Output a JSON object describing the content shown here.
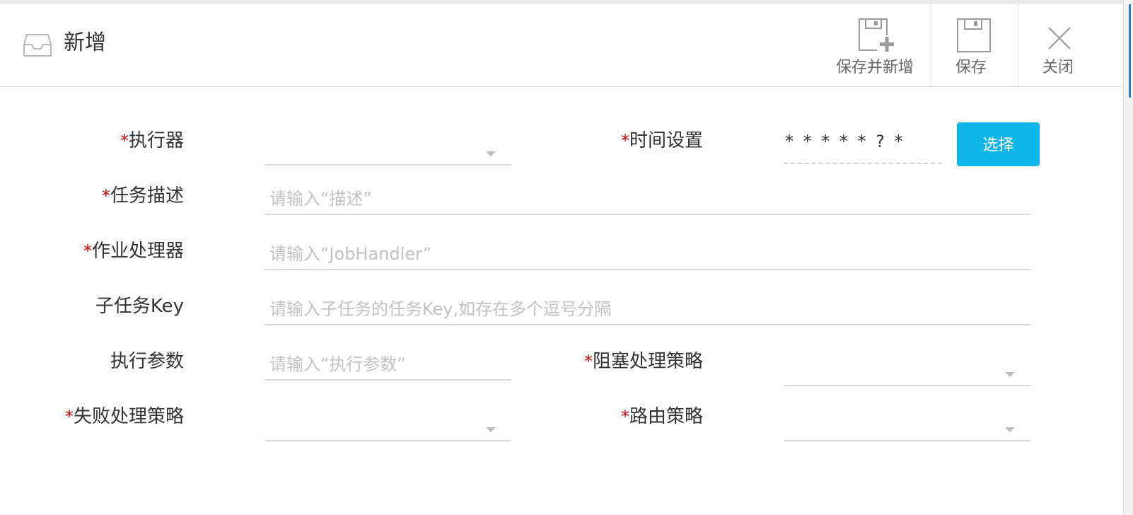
{
  "dialog": {
    "title": "新增",
    "icon": "inbox-icon"
  },
  "toolbar": {
    "save_and_new_label": "保存并新增",
    "save_label": "保存",
    "close_label": "关闭"
  },
  "form": {
    "required_mark": "*",
    "executor": {
      "label": "执行器",
      "value": ""
    },
    "time_setting": {
      "label": "时间设置",
      "value": "* * * * * ? *",
      "button_label": "选择"
    },
    "task_desc": {
      "label": "任务描述",
      "placeholder": "请输入“描述”"
    },
    "job_handler": {
      "label": "作业处理器",
      "placeholder": "请输入“JobHandler”"
    },
    "child_key": {
      "label": "子任务Key",
      "placeholder": "请输入子任务的任务Key,如存在多个逗号分隔"
    },
    "exec_params": {
      "label": "执行参数",
      "placeholder": "请输入“执行参数”"
    },
    "block_strategy": {
      "label": "阻塞处理策略",
      "value": ""
    },
    "fail_strategy": {
      "label": "失败处理策略",
      "value": ""
    },
    "route_strategy": {
      "label": "路由策略",
      "value": ""
    }
  },
  "colors": {
    "accent": "#10b5ea",
    "required": "#cc0000"
  }
}
